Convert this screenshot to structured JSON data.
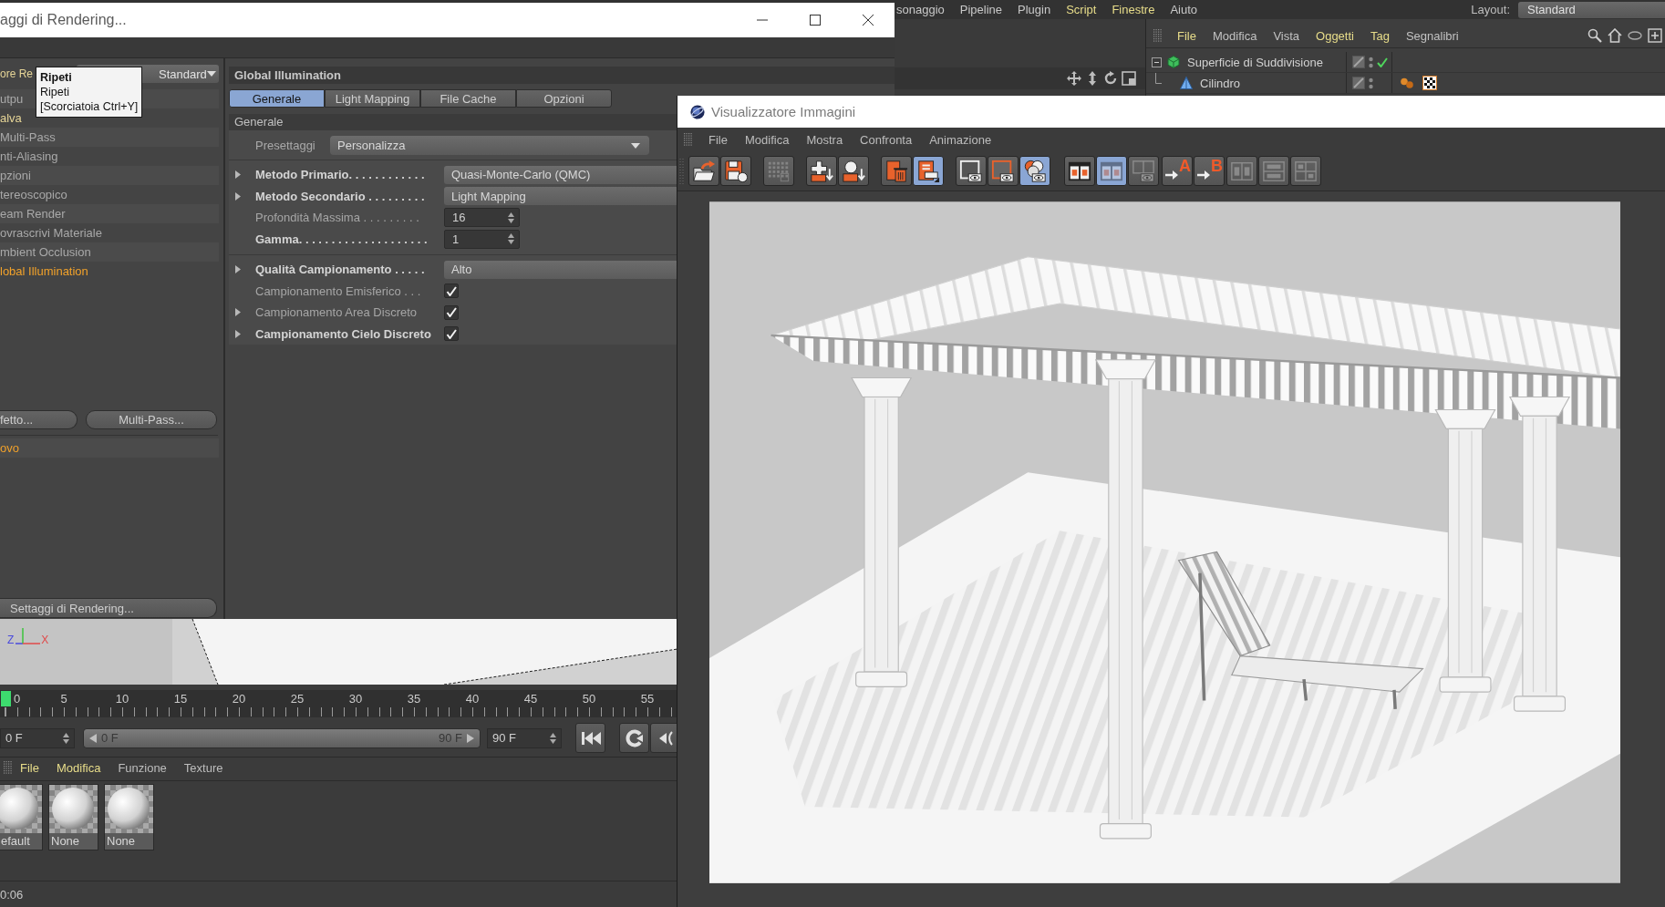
{
  "app_menu": {
    "items": [
      {
        "label": "sonaggio",
        "highlighted": false
      },
      {
        "label": "Pipeline",
        "highlighted": false
      },
      {
        "label": "Plugin",
        "highlighted": false
      },
      {
        "label": "Script",
        "highlighted": true
      },
      {
        "label": "Finestre",
        "highlighted": true
      },
      {
        "label": "Aiuto",
        "highlighted": false
      }
    ],
    "layout_label": "Layout:",
    "layout_value": "Standard"
  },
  "viewport_toolbar": [
    {
      "kind": "move"
    },
    {
      "kind": "pan"
    },
    {
      "kind": "rotate"
    },
    {
      "kind": "frame"
    }
  ],
  "object_manager": {
    "menu": [
      {
        "label": "File",
        "highlighted": true
      },
      {
        "label": "Modifica",
        "highlighted": false
      },
      {
        "label": "Vista",
        "highlighted": false
      },
      {
        "label": "Oggetti",
        "highlighted": true
      },
      {
        "label": "Tag",
        "highlighted": true
      },
      {
        "label": "Segnalibri",
        "highlighted": false
      }
    ],
    "tools": [
      {
        "kind": "search"
      },
      {
        "kind": "home"
      },
      {
        "kind": "ellipse"
      },
      {
        "kind": "add"
      }
    ],
    "objects": [
      {
        "name": "Superficie di Suddivisione",
        "kind": "subdivision",
        "expanded": true,
        "checked": true,
        "children": [
          {
            "name": "Cilindro",
            "kind": "cylinder",
            "checked": false,
            "tags": [
              {
                "kind": "dots"
              },
              {
                "kind": "checker"
              }
            ]
          }
        ]
      }
    ]
  },
  "render_settings": {
    "title": "aggi di Rendering...",
    "renderer": {
      "label": "ore Re",
      "value": "Standard"
    },
    "tooltip": {
      "title": "Ripeti",
      "lines": [
        "Ripeti",
        "[Scorciatoia Ctrl+Y]"
      ]
    },
    "sections": [
      {
        "label": "utpu",
        "selected": false,
        "highlighted": false
      },
      {
        "label": "alva",
        "selected": false,
        "highlighted": true
      },
      {
        "label": "Multi-Pass",
        "selected": false,
        "highlighted": false
      },
      {
        "label": "nti-Aliasing",
        "selected": false,
        "highlighted": false
      },
      {
        "label": "pzioni",
        "selected": false,
        "highlighted": false
      },
      {
        "label": "tereoscopico",
        "selected": false,
        "highlighted": false
      },
      {
        "label": "eam Render",
        "selected": false,
        "highlighted": false
      },
      {
        "label": "ovrascrivi Materiale",
        "selected": false,
        "highlighted": false
      },
      {
        "label": "mbient Occlusion",
        "selected": false,
        "highlighted": false
      },
      {
        "label": "lobal Illumination",
        "selected": true,
        "highlighted": false
      }
    ],
    "buttons": [
      "fetto...",
      "Multi-Pass..."
    ],
    "presets": [
      {
        "label": "ovo",
        "selected": true
      }
    ],
    "settings_button": "Settaggi di Rendering...",
    "global_illumination": {
      "title": "Global Illumination",
      "tabs": [
        {
          "label": "Generale",
          "selected": true
        },
        {
          "label": "Light Mapping",
          "selected": false
        },
        {
          "label": "File Cache",
          "selected": false
        },
        {
          "label": "Opzioni",
          "selected": false
        }
      ],
      "group_title": "Generale",
      "preset": {
        "label": "Presettaggi",
        "value": "Personalizza"
      },
      "param_groups": [
        {
          "params": [
            {
              "kind": "dropdown",
              "label": "Metodo Primario. . . . . . . . . . . .",
              "value": "Quasi-Monte-Carlo (QMC)",
              "bold": true,
              "expandable": true
            },
            {
              "kind": "dropdown",
              "label": "Metodo Secondario . . . . . . . . .",
              "value": "Light Mapping",
              "bold": true,
              "expandable": true
            },
            {
              "kind": "number",
              "label": "Profondità Massima . . . . . . . . .",
              "value": "16",
              "bold": false,
              "expandable": false
            },
            {
              "kind": "number",
              "label": "Gamma. . . . . . . . . . . . . . . . . . . .",
              "value": "1",
              "bold": true,
              "expandable": false
            }
          ]
        },
        {
          "params": [
            {
              "kind": "dropdown",
              "label": "Qualità Campionamento . . . . .",
              "value": "Alto",
              "bold": true,
              "expandable": true
            },
            {
              "kind": "checkbox",
              "label": "Campionamento Emisferico . . .",
              "checked": true,
              "bold": false,
              "expandable": false
            },
            {
              "kind": "checkbox",
              "label": "Campionamento Area Discreto",
              "checked": true,
              "bold": false,
              "expandable": true
            },
            {
              "kind": "checkbox",
              "label": "Campionamento Cielo Discreto",
              "checked": true,
              "bold": true,
              "expandable": true
            }
          ]
        }
      ]
    }
  },
  "image_viewer": {
    "title": "Visualizzatore Immagini",
    "menu": [
      "File",
      "Modifica",
      "Mostra",
      "Confronta",
      "Animazione"
    ],
    "toolbar": [
      {
        "tools": [
          {
            "kind": "open",
            "selected": false,
            "disabled": false
          },
          {
            "kind": "save",
            "selected": false,
            "disabled": false
          }
        ]
      },
      {
        "tools": [
          {
            "kind": "grid",
            "selected": false,
            "disabled": true
          }
        ]
      },
      {
        "tools": [
          {
            "kind": "cross-down",
            "selected": false,
            "disabled": false
          },
          {
            "kind": "sphere-down",
            "selected": false,
            "disabled": false
          }
        ]
      },
      {
        "tools": [
          {
            "kind": "trash",
            "selected": false,
            "disabled": false
          },
          {
            "kind": "document",
            "selected": true,
            "disabled": false
          }
        ]
      },
      {
        "tools": [
          {
            "kind": "frame-eye",
            "selected": false,
            "disabled": false
          },
          {
            "kind": "frame-eye-accent",
            "selected": false,
            "disabled": false
          },
          {
            "kind": "circles-eye",
            "selected": true,
            "disabled": false
          }
        ]
      },
      {
        "tools": [
          {
            "kind": "split",
            "selected": false,
            "disabled": false
          },
          {
            "kind": "split",
            "selected": true,
            "disabled": true
          },
          {
            "kind": "split-eye",
            "selected": false,
            "disabled": true
          }
        ]
      },
      {
        "tools": [
          {
            "kind": "arrow",
            "label": "A",
            "selected": false,
            "disabled": false
          },
          {
            "kind": "arrow",
            "label": "B",
            "selected": false,
            "disabled": false
          }
        ]
      },
      {
        "tools": [
          {
            "kind": "split-outline",
            "selected": false,
            "disabled": true
          },
          {
            "kind": "stacked",
            "selected": false,
            "disabled": true
          },
          {
            "kind": "quad",
            "selected": false,
            "disabled": true
          }
        ]
      }
    ]
  },
  "viewport": {
    "axes": [
      {
        "label": "Z",
        "color": "#4b4bdc"
      },
      {
        "label": "X",
        "color": "#e04a4a"
      }
    ]
  },
  "timeline": {
    "ticks": [
      "0",
      "5",
      "10",
      "15",
      "20",
      "25",
      "30",
      "35",
      "40",
      "45",
      "50",
      "55"
    ],
    "playhead": {
      "level": 0
    },
    "start_field": "0 F",
    "range": {
      "start": "0 F",
      "end": "90 F",
      "level": 1
    },
    "end_field": "90 F",
    "transport": [
      {
        "buttons": [
          {
            "kind": "go-start"
          }
        ]
      },
      {
        "buttons": [
          {
            "kind": "loop"
          },
          {
            "kind": "step-back"
          }
        ]
      }
    ]
  },
  "material_manager": {
    "menu": [
      {
        "label": "File",
        "highlighted": true
      },
      {
        "label": "Modifica",
        "highlighted": true
      },
      {
        "label": "Funzione",
        "highlighted": false
      },
      {
        "label": "Texture",
        "highlighted": false
      }
    ],
    "materials": [
      {
        "name": "efault"
      },
      {
        "name": "None"
      },
      {
        "name": "None"
      }
    ]
  },
  "status_bar": {
    "text": "0:06"
  }
}
